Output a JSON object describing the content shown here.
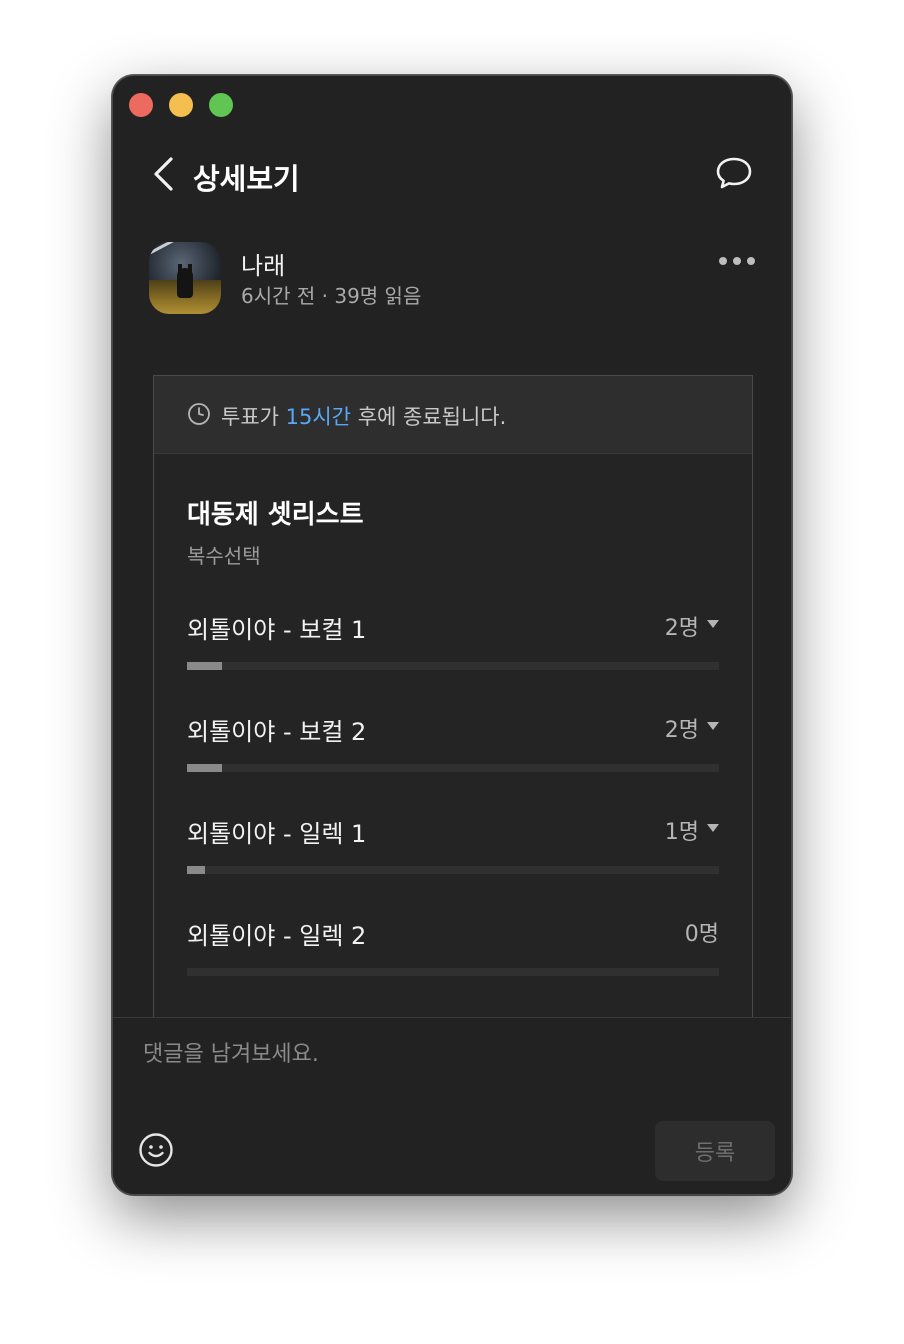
{
  "header": {
    "title": "상세보기"
  },
  "post": {
    "author_name": "나래",
    "meta": "6시간 전 · 39명 읽음"
  },
  "poll": {
    "banner_prefix": "투표가 ",
    "banner_highlight": "15시간",
    "banner_suffix": " 후에 종료됩니다.",
    "accent_color": "#59a7f5",
    "title": "대동제 셋리스트",
    "subtitle": "복수선택",
    "options": [
      {
        "label": "외톨이야 - 보컬 1",
        "count": "2명",
        "share": 0.0667
      },
      {
        "label": "외톨이야 - 보컬 2",
        "count": "2명",
        "share": 0.0667
      },
      {
        "label": "외톨이야 - 일렉 1",
        "count": "1명",
        "share": 0.0333
      },
      {
        "label": "외톨이야 - 일렉 2",
        "count": "0명",
        "share": 0
      }
    ]
  },
  "composer": {
    "placeholder": "댓글을 남겨보세요.",
    "submit_label": "등록"
  },
  "icons": {
    "back": "chevron-left-icon",
    "comment": "speech-bubble-icon",
    "more": "ellipsis-icon",
    "clock": "clock-icon",
    "emoji": "smiley-icon"
  }
}
